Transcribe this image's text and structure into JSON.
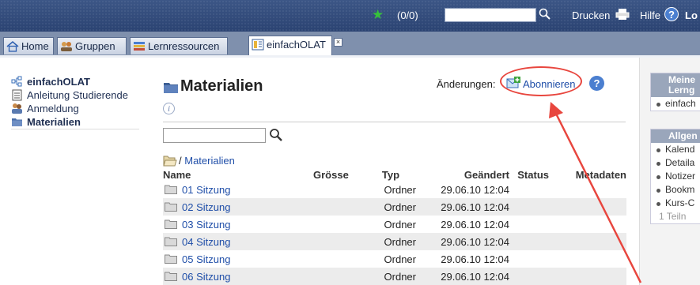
{
  "topbar": {
    "count": "(0/0)",
    "search_value": "",
    "print_label": "Drucken",
    "help_label": "Hilfe",
    "login_label": "Lo"
  },
  "tabs": [
    {
      "label": "Home",
      "icon": "home-icon"
    },
    {
      "label": "Gruppen",
      "icon": "groups-icon"
    },
    {
      "label": "Lernressourcen",
      "icon": "learning-resources-icon"
    },
    {
      "label": "einfachOLAT",
      "icon": "course-icon",
      "active": true
    }
  ],
  "nav": {
    "items": [
      {
        "label": "einfachOLAT",
        "icon": "course-tree-icon"
      },
      {
        "label": "Anleitung Studierende",
        "icon": "document-icon"
      },
      {
        "label": "Anmeldung",
        "icon": "enrollment-icon"
      },
      {
        "label": "Materialien",
        "icon": "folder-icon"
      }
    ]
  },
  "main": {
    "title": "Materialien",
    "changes_label": "Änderungen:",
    "subscribe_label": "Abonnieren",
    "search_placeholder": "",
    "path_root": "/",
    "path_current": "Materialien",
    "columns": [
      "Name",
      "Grösse",
      "Typ",
      "Geändert",
      "Status",
      "Metadaten"
    ],
    "rows": [
      {
        "name": "01 Sitzung",
        "size": "",
        "type": "Ordner",
        "modified": "29.06.10 12:04"
      },
      {
        "name": "02 Sitzung",
        "size": "",
        "type": "Ordner",
        "modified": "29.06.10 12:04"
      },
      {
        "name": "03 Sitzung",
        "size": "",
        "type": "Ordner",
        "modified": "29.06.10 12:04"
      },
      {
        "name": "04 Sitzung",
        "size": "",
        "type": "Ordner",
        "modified": "29.06.10 12:04"
      },
      {
        "name": "05 Sitzung",
        "size": "",
        "type": "Ordner",
        "modified": "29.06.10 12:04"
      },
      {
        "name": "06 Sitzung",
        "size": "",
        "type": "Ordner",
        "modified": "29.06.10 12:04"
      }
    ]
  },
  "sidebar": {
    "box1": {
      "title_line1": "Meine",
      "title_line2": "Lerng",
      "items": [
        "einfach"
      ]
    },
    "box2": {
      "title": "Allgen",
      "items": [
        "Kalend",
        "Detaila",
        "Notizer",
        "Bookm",
        "Kurs-C"
      ],
      "footer": "1 Teiln"
    }
  },
  "colors": {
    "topbar": "#2b4372",
    "link": "#1f4ea8",
    "highlight": "#e8463e"
  }
}
